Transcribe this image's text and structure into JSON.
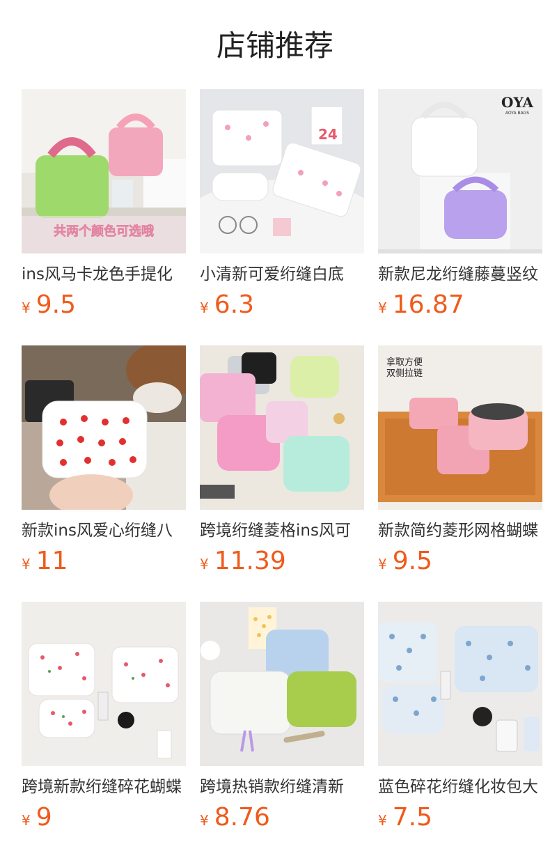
{
  "page": {
    "title": "店铺推荐",
    "currency_symbol": "¥",
    "price_color": "#f05a1a"
  },
  "products": [
    {
      "name": "ins风马卡龙色手提化",
      "price": "9.5",
      "image_caption": "共两个颜色可选哦"
    },
    {
      "name": "小清新可爱绗缝白底",
      "price": "6.3",
      "image_badge": "24"
    },
    {
      "name": "新款尼龙绗缝藤蔓竖纹",
      "price": "16.87",
      "image_brand": "OYA",
      "image_brand_sub": "AOYA BAGS"
    },
    {
      "name": "新款ins风爱心绗缝八",
      "price": "11"
    },
    {
      "name": "跨境绗缝菱格ins风可",
      "price": "11.39"
    },
    {
      "name": "新款简约菱形网格蝴蝶",
      "price": "9.5",
      "image_caption": "拿取方便",
      "image_caption_2": "双侧拉链"
    },
    {
      "name": "跨境新款绗缝碎花蝴蝶",
      "price": "9"
    },
    {
      "name": "跨境热销款绗缝清新",
      "price": "8.76"
    },
    {
      "name": "蓝色碎花绗缝化妆包大",
      "price": "7.5"
    }
  ]
}
